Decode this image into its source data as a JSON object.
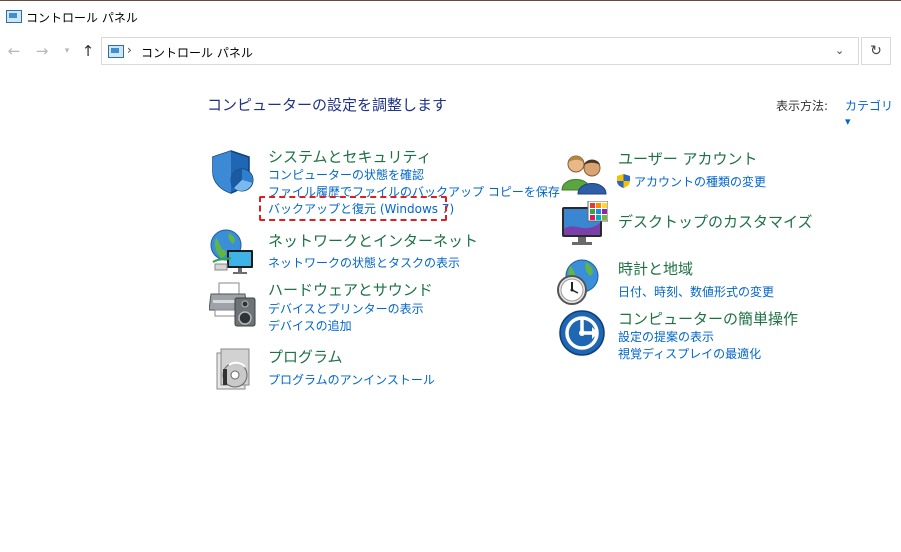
{
  "window": {
    "title": "コントロール パネル"
  },
  "nav": {
    "back_icon": "back-arrow-icon",
    "forward_icon": "forward-arrow-icon",
    "up_icon": "up-arrow-icon",
    "address_separator": "›",
    "address_text": "コントロール パネル",
    "dropdown_glyph": "⌄",
    "refresh_glyph": "↻"
  },
  "main": {
    "title": "コンピューターの設定を調整します",
    "view_by_label": "表示方法:",
    "view_by_value": "カテゴリ"
  },
  "categories": {
    "system": {
      "title": "システムとセキュリティ",
      "links": [
        "コンピューターの状態を確認",
        "ファイル履歴でファイルのバックアップ コピーを保存",
        "バックアップと復元 (Windows 7)"
      ]
    },
    "network": {
      "title": "ネットワークとインターネット",
      "links": [
        "ネットワークの状態とタスクの表示"
      ]
    },
    "hardware": {
      "title": "ハードウェアとサウンド",
      "links": [
        "デバイスとプリンターの表示",
        "デバイスの追加"
      ]
    },
    "programs": {
      "title": "プログラム",
      "links": [
        "プログラムのアンインストール"
      ]
    },
    "users": {
      "title": "ユーザー アカウント",
      "links": [
        "アカウントの種類の変更"
      ]
    },
    "appearance": {
      "title": "デスクトップのカスタマイズ",
      "links": []
    },
    "clock": {
      "title": "時計と地域",
      "links": [
        "日付、時刻、数値形式の変更"
      ]
    },
    "ease": {
      "title": "コンピューターの簡単操作",
      "links": [
        "設定の提案の表示",
        "視覚ディスプレイの最適化"
      ]
    }
  },
  "colors": {
    "category_title": "#1e7145",
    "link": "#0066cc",
    "heading": "#1e3287",
    "highlight": "#e02020"
  }
}
